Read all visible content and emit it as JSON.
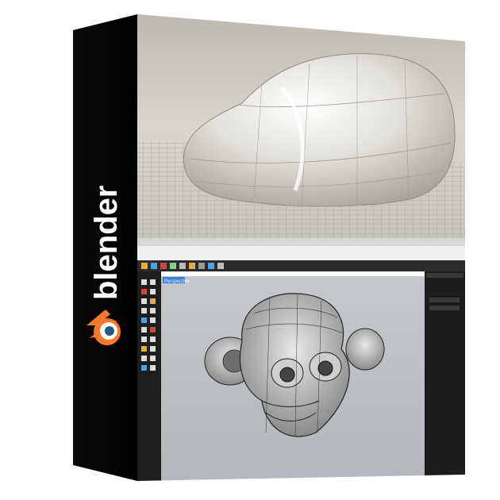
{
  "brand": {
    "name": "blender",
    "text_color": "#ffffff",
    "logo_orange": "#f5792a",
    "logo_blue": "#265787"
  },
  "cover": {
    "spine_color": "#050505",
    "icon": "blender-logo-icon"
  },
  "viewport_top": {
    "subject": "car-body-render"
  },
  "viewport_bottom": {
    "tab_label": "Perspective",
    "subject": "monkey-head-wireframe"
  },
  "colors": {
    "viewport_bg": "#c9ccd0",
    "render_bg": "#d8d4cc",
    "ui_dark": "#1c1c1c",
    "ui_panel": "#2a2a2a",
    "accent_tab": "#3d7bd6"
  }
}
